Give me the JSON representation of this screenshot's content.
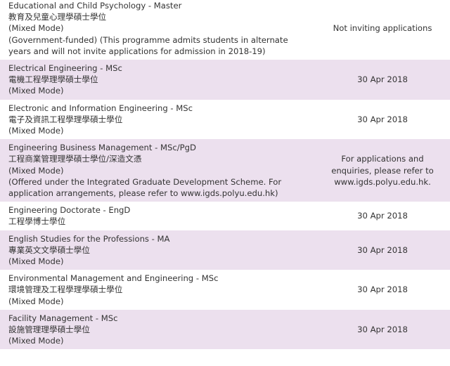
{
  "programmes": [
    {
      "title": "Educational and Child Psychology - Master",
      "chinese": "教育及兒童心理學碩士學位",
      "mode": "(Mixed Mode)",
      "note": "(Government-funded) (This programme admits students in alternate years and will not invite applications for admission in 2018-19)",
      "deadline": "Not inviting applications"
    },
    {
      "title": "Electrical Engineering - MSc",
      "chinese": "電機工程學理學碩士學位",
      "mode": "(Mixed Mode)",
      "note": "",
      "deadline": "30 Apr 2018"
    },
    {
      "title": "Electronic and Information Engineering - MSc",
      "chinese": "電子及資訊工程學理學碩士學位",
      "mode": "(Mixed Mode)",
      "note": "",
      "deadline": "30 Apr 2018"
    },
    {
      "title": "Engineering Business Management - MSc/PgD",
      "chinese": "工程商業管理理學碩士學位/深造文憑",
      "mode": "(Mixed Mode)",
      "note": "(Offered under the Integrated Graduate Development Scheme. For application arrangements, please refer to www.igds.polyu.edu.hk)",
      "deadline": "For applications and enquiries, please refer to www.igds.polyu.edu.hk."
    },
    {
      "title": "Engineering Doctorate - EngD",
      "chinese": "工程學博士學位",
      "mode": "",
      "note": "",
      "deadline": "30 Apr 2018"
    },
    {
      "title": "English Studies for the Professions - MA",
      "chinese": "專業英文文學碩士學位",
      "mode": "(Mixed Mode)",
      "note": "",
      "deadline": "30 Apr 2018"
    },
    {
      "title": "Environmental Management and Engineering - MSc",
      "chinese": "環境管理及工程學理學碩士學位",
      "mode": "(Mixed Mode)",
      "note": "",
      "deadline": "30 Apr 2018"
    },
    {
      "title": "Facility Management - MSc",
      "chinese": "設施管理理學碩士學位",
      "mode": "(Mixed Mode)",
      "note": "",
      "deadline": "30 Apr 2018"
    }
  ]
}
